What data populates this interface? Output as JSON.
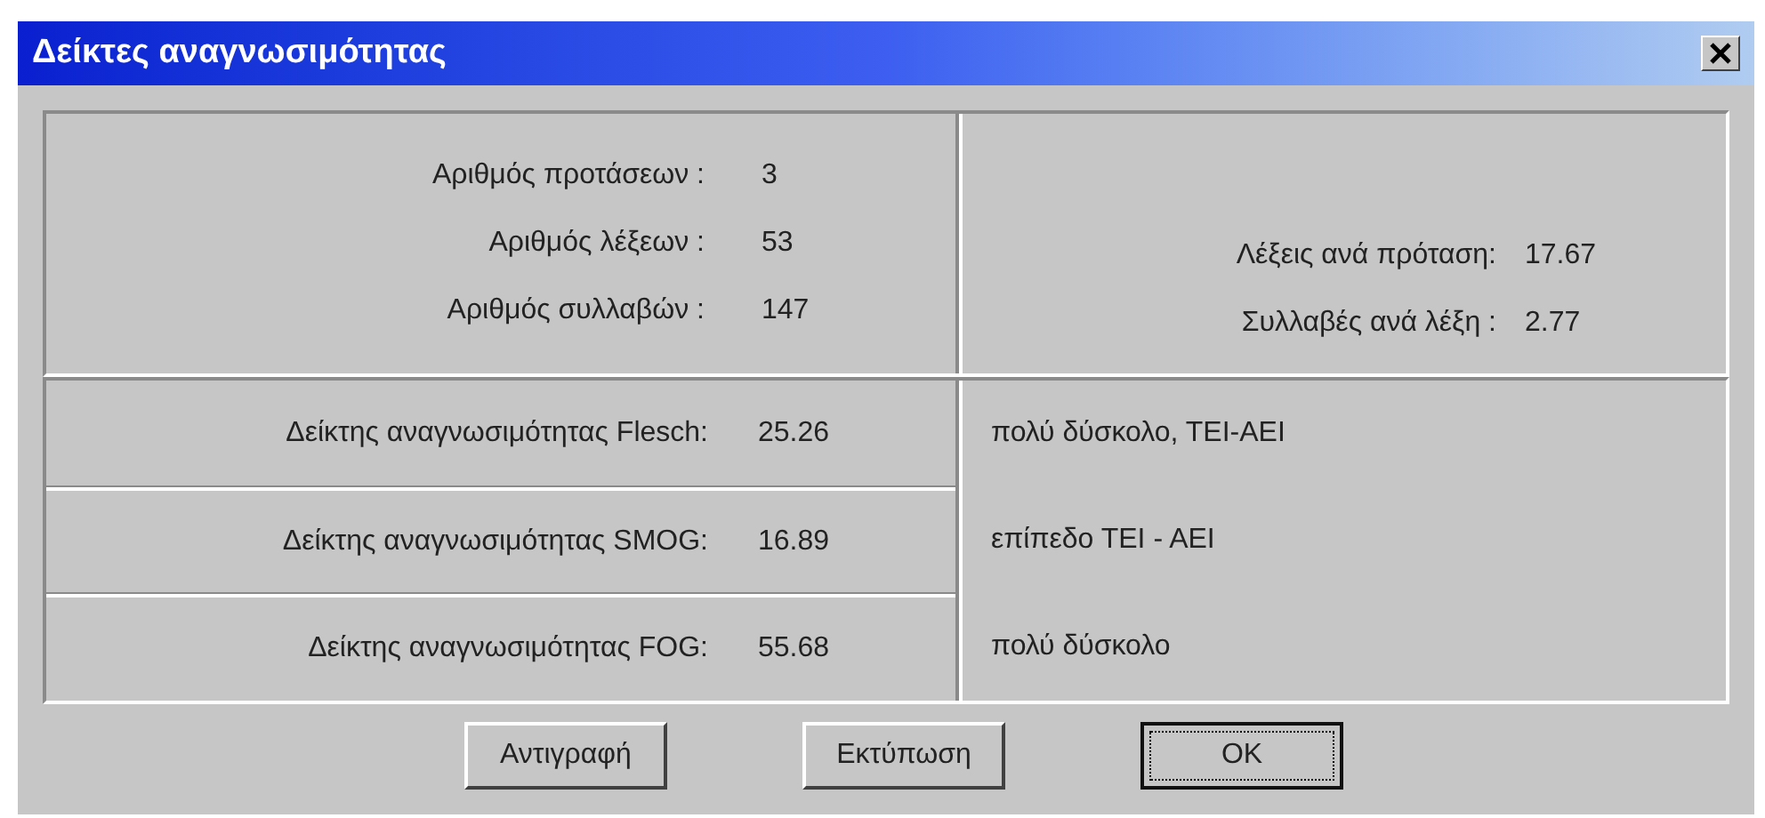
{
  "window": {
    "title": "Δείκτες αναγνωσιμότητας"
  },
  "counts": [
    {
      "label": "Αριθμός προτάσεων :",
      "value": "3"
    },
    {
      "label": "Αριθμός λέξεων :",
      "value": "53"
    },
    {
      "label": "Αριθμός συλλαβών :",
      "value": "147"
    }
  ],
  "ratios": [
    {
      "label": "Λέξεις ανά πρόταση:",
      "value": "17.67"
    },
    {
      "label": "Συλλαβές ανά λέξη :",
      "value": "2.77"
    }
  ],
  "indices": [
    {
      "label": "Δείκτης αναγνωσιμότητας Flesch:",
      "value": "25.26",
      "assessment": "πολύ δύσκολο, ΤΕΙ-ΑΕΙ"
    },
    {
      "label": "Δείκτης αναγνωσιμότητας SMOG:",
      "value": "16.89",
      "assessment": "επίπεδο ΤΕΙ - ΑΕΙ"
    },
    {
      "label": "Δείκτης αναγνωσιμότητας FOG:",
      "value": "55.68",
      "assessment": "πολύ δύσκολο"
    }
  ],
  "buttons": [
    {
      "label": "Αντιγραφή",
      "focused": false
    },
    {
      "label": "Εκτύπωση",
      "focused": false
    },
    {
      "label": "OK",
      "focused": true
    }
  ]
}
